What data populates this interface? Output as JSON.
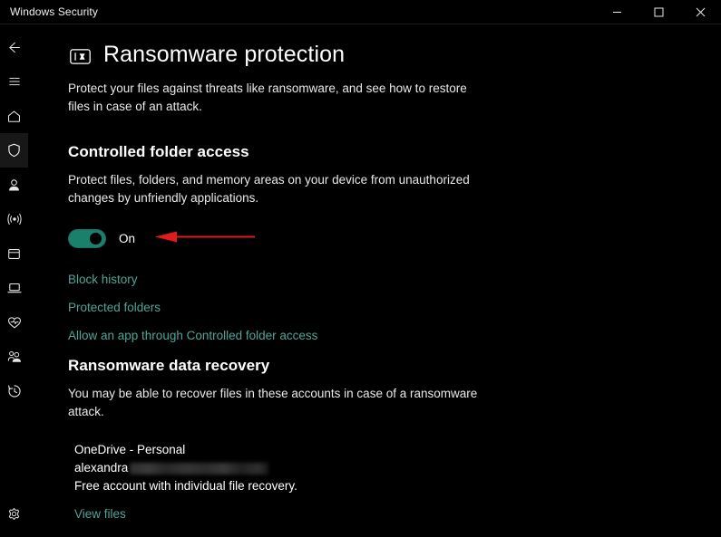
{
  "window": {
    "title": "Windows Security",
    "caption": {
      "minimize": "minimize",
      "maximize": "maximize",
      "close": "close"
    }
  },
  "sidebar": {
    "items": [
      {
        "icon": "back-arrow-icon",
        "label": "Back"
      },
      {
        "icon": "hamburger-menu-icon",
        "label": "Menu"
      },
      {
        "icon": "home-icon",
        "label": "Home"
      },
      {
        "icon": "shield-icon",
        "label": "Virus & threat protection",
        "selected": true
      },
      {
        "icon": "person-icon",
        "label": "Account protection"
      },
      {
        "icon": "wifi-signal-icon",
        "label": "Firewall & network protection"
      },
      {
        "icon": "app-window-icon",
        "label": "App & browser control"
      },
      {
        "icon": "laptop-icon",
        "label": "Device security"
      },
      {
        "icon": "heart-pulse-icon",
        "label": "Device performance & health"
      },
      {
        "icon": "family-people-icon",
        "label": "Family options"
      },
      {
        "icon": "history-clock-icon",
        "label": "Protection history"
      }
    ],
    "bottom": {
      "icon": "gear-icon",
      "label": "Settings"
    }
  },
  "page": {
    "icon": "ransomware-protection-icon",
    "title": "Ransomware protection",
    "description": "Protect your files against threats like ransomware, and see how to restore files in case of an attack."
  },
  "controlled_folder_access": {
    "title": "Controlled folder access",
    "description": "Protect files, folders, and memory areas on your device from unauthorized changes by unfriendly applications.",
    "toggle_state": "On",
    "toggle_on": true,
    "links": [
      "Block history",
      "Protected folders",
      "Allow an app through Controlled folder access"
    ]
  },
  "ransomware_data_recovery": {
    "title": "Ransomware data recovery",
    "description": "You may be able to recover files in these accounts in case of a ransomware attack.",
    "account": {
      "name": "OneDrive - Personal",
      "email_prefix": "alexandra",
      "email_redacted": true,
      "note": "Free account with individual file recovery.",
      "link": "View files"
    }
  },
  "annotation": {
    "type": "red-arrow-left",
    "color": "#e01b1b",
    "points_to": "controlled-folder-access-toggle"
  },
  "colors": {
    "background": "#000000",
    "toggle_accent": "#1a7f6b",
    "link": "#4ea59a",
    "annotation_red": "#e01b1b",
    "text_primary": "#ffffff"
  }
}
